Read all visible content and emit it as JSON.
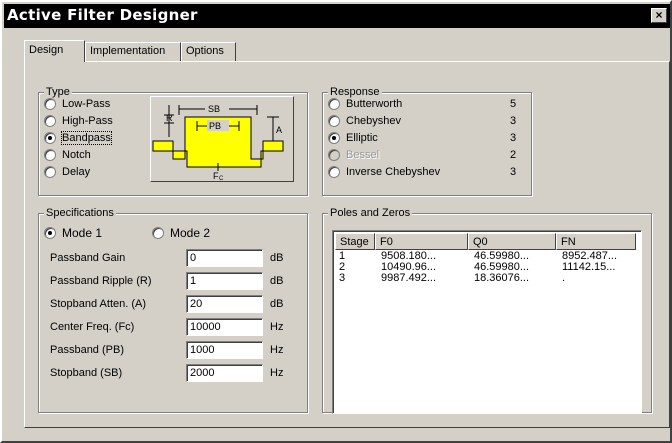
{
  "window": {
    "title": "Active Filter Designer",
    "close_glyph": "×"
  },
  "tabs": [
    {
      "label": "Design",
      "active": true
    },
    {
      "label": "Implementation",
      "active": false
    },
    {
      "label": "Options",
      "active": false
    }
  ],
  "type_group": {
    "title": "Type",
    "options": [
      {
        "label": "Low-Pass",
        "checked": false
      },
      {
        "label": "High-Pass",
        "checked": false
      },
      {
        "label": "Bandpass",
        "checked": true
      },
      {
        "label": "Notch",
        "checked": false
      },
      {
        "label": "Delay",
        "checked": false
      }
    ],
    "diagram": {
      "sb": "SB",
      "pb": "PB",
      "a": "A",
      "r": "R",
      "fc": "F",
      "fc_sub": "C",
      "fill_color": "#ffff00"
    }
  },
  "response_group": {
    "title": "Response",
    "options": [
      {
        "label": "Butterworth",
        "order": "5",
        "checked": false,
        "disabled": false
      },
      {
        "label": "Chebyshev",
        "order": "3",
        "checked": false,
        "disabled": false
      },
      {
        "label": "Elliptic",
        "order": "3",
        "checked": true,
        "disabled": false
      },
      {
        "label": "Bessel",
        "order": "2",
        "checked": false,
        "disabled": true
      },
      {
        "label": "Inverse Chebyshev",
        "order": "3",
        "checked": false,
        "disabled": false
      }
    ]
  },
  "specifications": {
    "title": "Specifications",
    "modes": [
      {
        "label": "Mode 1",
        "checked": true
      },
      {
        "label": "Mode 2",
        "checked": false
      }
    ],
    "fields": [
      {
        "label": "Passband Gain",
        "value": "0",
        "unit": "dB"
      },
      {
        "label": "Passband Ripple (R)",
        "value": "1",
        "unit": "dB"
      },
      {
        "label": "Stopband Atten. (A)",
        "value": "20",
        "unit": "dB"
      },
      {
        "label": "Center Freq. (Fc)",
        "value": "10000",
        "unit": "Hz"
      },
      {
        "label": "Passband (PB)",
        "value": "1000",
        "unit": "Hz"
      },
      {
        "label": "Stopband (SB)",
        "value": "2000",
        "unit": "Hz"
      }
    ]
  },
  "poles_zeros": {
    "title": "Poles and Zeros",
    "columns": [
      "Stage",
      "F0",
      "Q0",
      "FN"
    ],
    "rows": [
      [
        "1",
        "9508.180...",
        "46.59980...",
        "8952.487..."
      ],
      [
        "2",
        "10490.96...",
        "46.59980...",
        "11142.15..."
      ],
      [
        "3",
        "9987.492...",
        "18.36076...",
        "."
      ]
    ]
  }
}
